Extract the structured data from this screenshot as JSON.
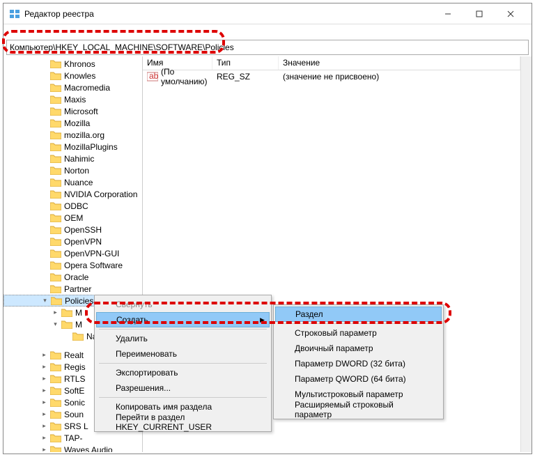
{
  "window": {
    "title": "Редактор реестра"
  },
  "address": {
    "path": "Компьютер\\HKEY_LOCAL_MACHINE\\SOFTWARE\\Policies"
  },
  "columns": {
    "name": "Имя",
    "type": "Тип",
    "value": "Значение"
  },
  "list_row": {
    "name": "(По умолчанию)",
    "type": "REG_SZ",
    "value": "(значение не присвоено)"
  },
  "tree": {
    "items": [
      "Khronos",
      "Knowles",
      "Macromedia",
      "Maxis",
      "Microsoft",
      "Mozilla",
      "mozilla.org",
      "MozillaPlugins",
      "Nahimic",
      "Norton",
      "Nuance",
      "NVIDIA Corporation",
      "ODBC",
      "OEM",
      "OpenSSH",
      "OpenVPN",
      "OpenVPN-GUI",
      "Opera Software",
      "Oracle",
      "Partner"
    ],
    "selected": "Policies",
    "sub1": "M",
    "sub2": "M",
    "sub2_child": "Nahimic",
    "tail": [
      "Realt",
      "Regis",
      "RTLS",
      "SoftE",
      "Sonic",
      "Soun",
      "SRS L",
      "TAP-",
      "Waves Audio"
    ]
  },
  "ctx1": {
    "collapse": "Свернуть",
    "create": "Создать",
    "delete": "Удалить",
    "rename": "Переименовать",
    "export": "Экспортировать",
    "perms": "Разрешения...",
    "copy": "Копировать имя раздела",
    "goto": "Перейти в раздел HKEY_CURRENT_USER"
  },
  "ctx2": {
    "key": "Раздел",
    "string": "Строковый параметр",
    "binary": "Двоичный параметр",
    "dword": "Параметр DWORD (32 бита)",
    "qword": "Параметр QWORD (64 бита)",
    "multi": "Мультистроковый параметр",
    "expand": "Расширяемый строковый параметр"
  }
}
